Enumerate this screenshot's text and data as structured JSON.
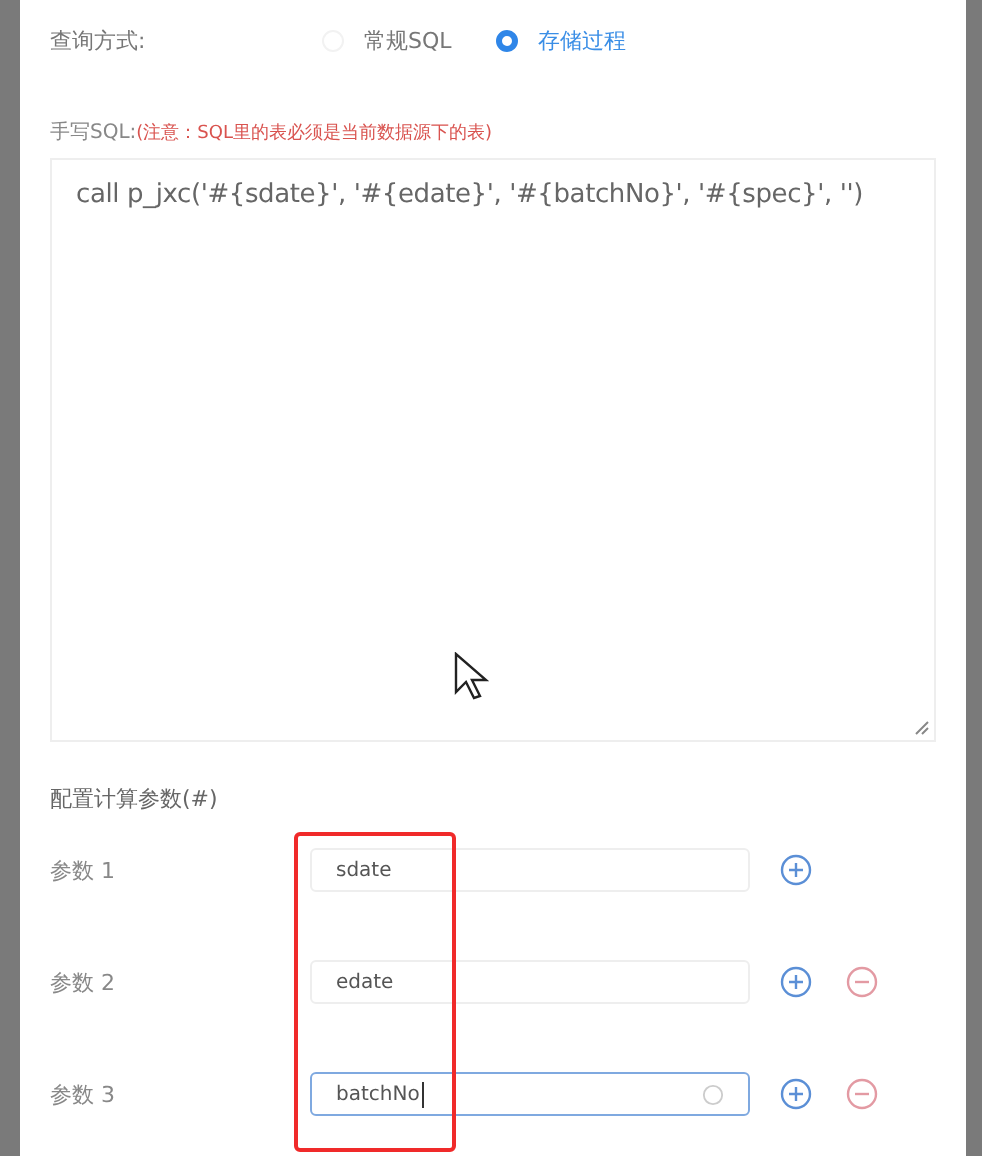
{
  "query_mode": {
    "label": "查询方式:",
    "options": [
      {
        "label": "常规SQL",
        "selected": false
      },
      {
        "label": "存储过程",
        "selected": true
      }
    ]
  },
  "sql": {
    "label": "手写SQL:",
    "note": "(注意：SQL里的表必须是当前数据源下的表)",
    "value": "call p_jxc('#{sdate}', '#{edate}', '#{batchNo}', '#{spec}', '')"
  },
  "params": {
    "title": "配置计算参数(#)",
    "rows": [
      {
        "label": "参数 1",
        "value": "sdate",
        "focused": false,
        "removable": false
      },
      {
        "label": "参数 2",
        "value": "edate",
        "focused": false,
        "removable": true
      },
      {
        "label": "参数 3",
        "value": "batchNo",
        "focused": true,
        "removable": true
      }
    ]
  }
}
